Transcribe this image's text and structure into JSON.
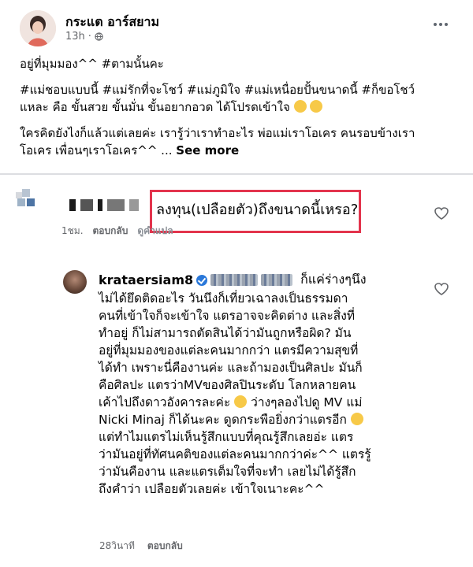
{
  "post": {
    "author": "กระแต อาร์สยาม",
    "time": "13h",
    "line1": "อยู่ที่มุมมอง^^ #ตามนั้นคะ",
    "line2a": "#แม่ชอบแบบนี้ #แม่รักที่จะโชว์ #แม่ภูมิใจ #แม่เหนื่อยปั้นขนาดนี้ #ก็ขอโชว์",
    "line2b": "แหละ คือ ขั้นสวย ขั้นมั่น ขั้นอยากอวด ได้โปรดเข้าใจ",
    "line3a": "ใครคิดยังไงก็แล้วแต่เลยค่ะ เรารู้ว่าเราทำอะไร พ่อแม่เราโอเคร คนรอบข้างเรา",
    "line3b": "โอเคร เพื่อนๆเราโอเคร^^ ...",
    "see_more": "See more"
  },
  "comment1": {
    "text": "ลงทุน(เปลือยตัว)ถึงขนาดนี้เหรอ?",
    "time": "1ชม.",
    "reply": "ตอบกลับ",
    "translate": "ดูคำแปล"
  },
  "comment2": {
    "name": "krataersiam8",
    "lines": [
      "ก็แค่ร่างๆนึง",
      "ไม่ได้ยึดติดอะไร วันนึงก็เที่ยวเฉาลงเป็นธรรมดา",
      "คนที่เข้าใจก็จะเข้าใจ แตรอาจจะคิดต่าง และสิ่งที่",
      "ทำอยู่ ก็ไม่สามารถตัดสินได้ว่ามันถูกหรือผิด?  มัน",
      "อยู่ที่มุมมองของแต่ละคนมากกว่า แตรมีความสุขที่",
      "ได้ทำ เพราะนี่คืองานค่ะ และถ้ามองเป็นศิลปะ มันก็",
      "คือศิลปะ แตรว่าMVของศิลปินระดับ โลกหลายคน",
      "เค้าไปถึงดาวอังคารละค่ะ",
      "ว่างๆลองไปดู MV แม่",
      "Nicki Minaj ก็ได้นะคะ ดูดกระพือยิ่งกว่าแตรอีก",
      "แต่ทำไมแตรไม่เห็นรู้สึกแบบที่คุณรู้สึกเลยอ่ะ แตร",
      "ว่ามันอยู่ที่ทัศนคติของแต่ละคนมากกว่าค่ะ^^ แตรรู้",
      "ว่ามันคืองาน และแตรเต็มใจที่จะทำ เลยไม่ได้รู้สึก",
      "ถึงคำว่า เปลือยตัวเลยค่ะ เข้าใจเนาะคะ^^"
    ],
    "time": "28วินาที",
    "reply": "ตอบกลับ"
  }
}
